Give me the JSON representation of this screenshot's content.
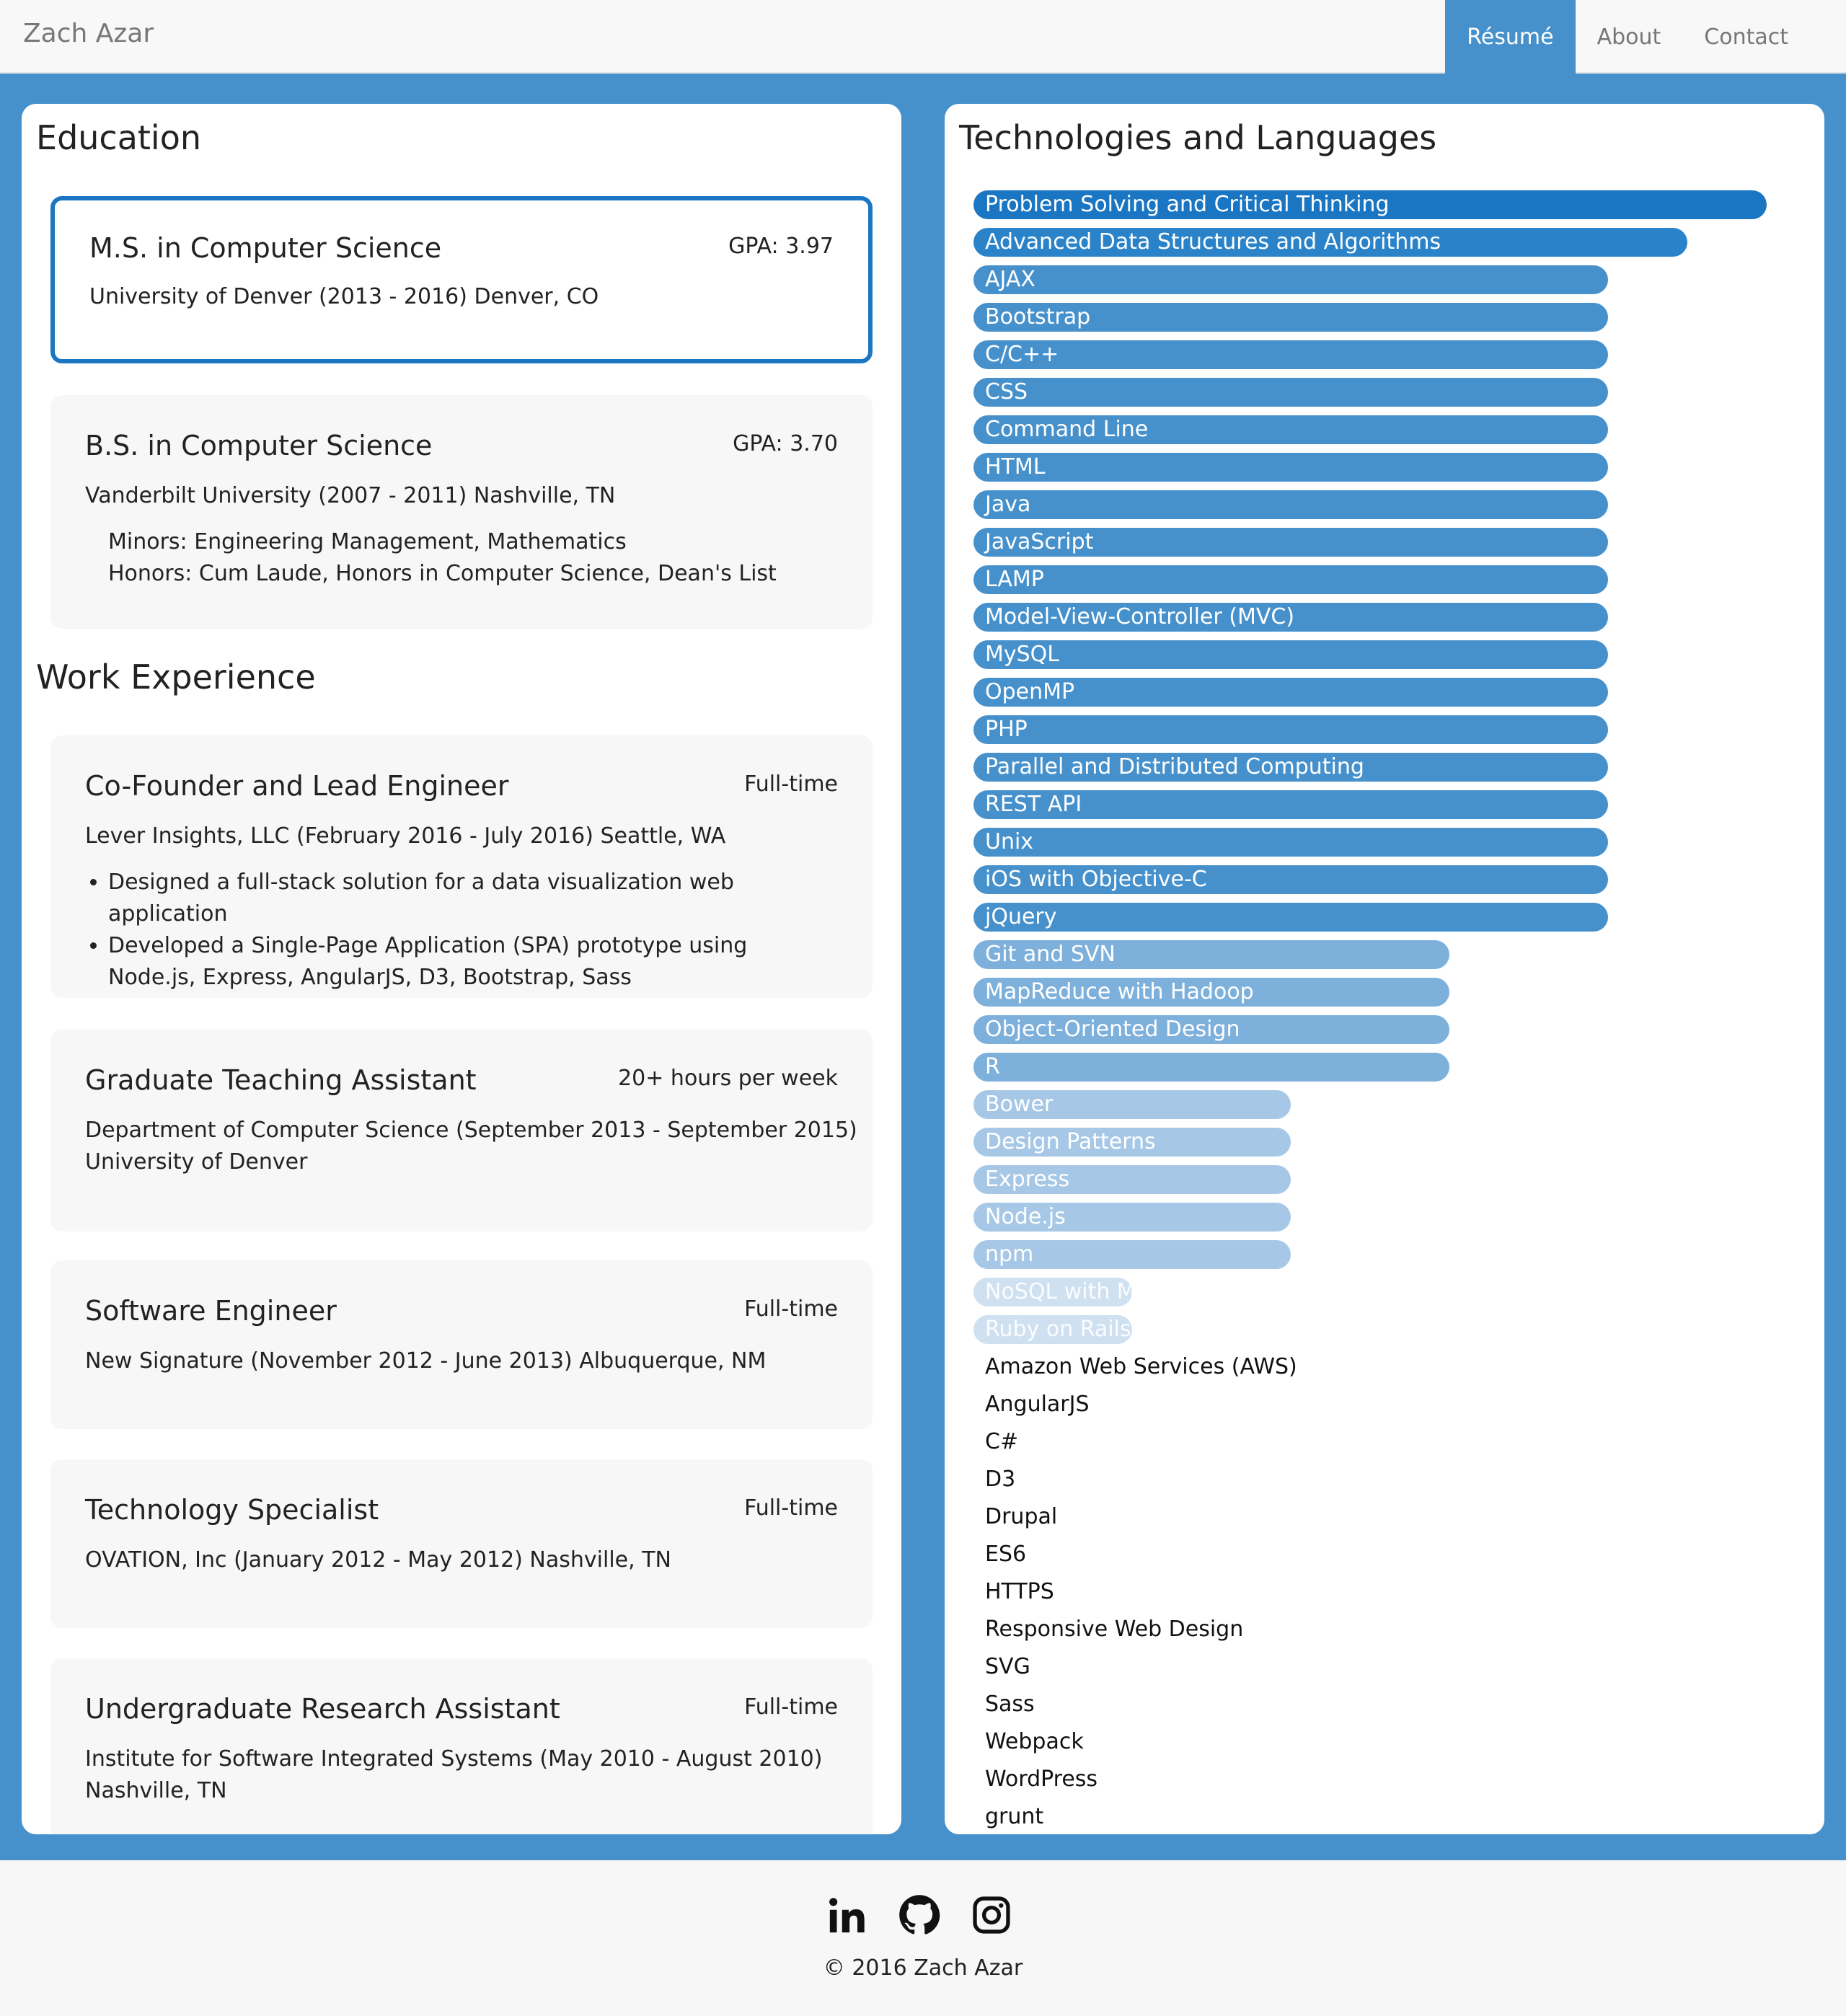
{
  "header": {
    "brand": "Zach Azar",
    "nav": [
      {
        "label": "Résumé",
        "active": true
      },
      {
        "label": "About",
        "active": false
      },
      {
        "label": "Contact",
        "active": false
      }
    ]
  },
  "education": {
    "title": "Education",
    "items": [
      {
        "degree": "M.S. in Computer Science",
        "gpa": "GPA: 3.97",
        "school": "University of Denver (2013 - 2016) Denver, CO"
      },
      {
        "degree": "B.S. in Computer Science",
        "gpa": "GPA: 3.70",
        "school": "Vanderbilt University (2007 - 2011) Nashville, TN",
        "minors": "Minors: Engineering Management, Mathematics",
        "honors": "Honors: Cum Laude, Honors in Computer Science, Dean's List"
      }
    ]
  },
  "work": {
    "title": "Work Experience",
    "items": [
      {
        "role": "Co-Founder and Lead Engineer",
        "type": "Full-time",
        "org": "Lever Insights, LLC (February 2016 - July 2016) Seattle, WA",
        "bullets": [
          "Designed a full-stack solution for a data visualization web application",
          "Developed a Single-Page Application (SPA) prototype using Node.js, Express, AngularJS, D3, Bootstrap, Sass"
        ]
      },
      {
        "role": "Graduate Teaching Assistant",
        "type": "20+ hours per week",
        "org": "Department of Computer Science (September 2013 - September 2015)",
        "org2": "University of Denver"
      },
      {
        "role": "Software Engineer",
        "type": "Full-time",
        "org": "New Signature (November 2012 - June 2013) Albuquerque, NM"
      },
      {
        "role": "Technology Specialist",
        "type": "Full-time",
        "org": "OVATION, Inc (January 2012 - May 2012) Nashville, TN"
      },
      {
        "role": "Undergraduate Research Assistant",
        "type": "Full-time",
        "org": "Institute for Software Integrated Systems (May 2010 - August 2010)",
        "org2": "Nashville, TN"
      }
    ]
  },
  "tech": {
    "title": "Technologies and Languages",
    "levels": {
      "10": "#1a76c2",
      "9": "#2a83c9",
      "8": "#4691cc",
      "6": "#7eb0dc",
      "4": "#a6c8e6",
      "2": "#cfe0f0"
    },
    "skills": [
      {
        "name": "Problem Solving and Critical Thinking",
        "level": 10
      },
      {
        "name": "Advanced Data Structures and Algorithms",
        "level": 9
      },
      {
        "name": "AJAX",
        "level": 8
      },
      {
        "name": "Bootstrap",
        "level": 8
      },
      {
        "name": "C/C++",
        "level": 8
      },
      {
        "name": "CSS",
        "level": 8
      },
      {
        "name": "Command Line",
        "level": 8
      },
      {
        "name": "HTML",
        "level": 8
      },
      {
        "name": "Java",
        "level": 8
      },
      {
        "name": "JavaScript",
        "level": 8
      },
      {
        "name": "LAMP",
        "level": 8
      },
      {
        "name": "Model-View-Controller (MVC)",
        "level": 8
      },
      {
        "name": "MySQL",
        "level": 8
      },
      {
        "name": "OpenMP",
        "level": 8
      },
      {
        "name": "PHP",
        "level": 8
      },
      {
        "name": "Parallel and Distributed Computing",
        "level": 8
      },
      {
        "name": "REST API",
        "level": 8
      },
      {
        "name": "Unix",
        "level": 8
      },
      {
        "name": "iOS with Objective-C",
        "level": 8
      },
      {
        "name": "jQuery",
        "level": 8
      },
      {
        "name": "Git and SVN",
        "level": 6
      },
      {
        "name": "MapReduce with Hadoop",
        "level": 6
      },
      {
        "name": "Object-Oriented Design",
        "level": 6
      },
      {
        "name": "R",
        "level": 6
      },
      {
        "name": "Bower",
        "level": 4
      },
      {
        "name": "Design Patterns",
        "level": 4
      },
      {
        "name": "Express",
        "level": 4
      },
      {
        "name": "Node.js",
        "level": 4
      },
      {
        "name": "npm",
        "level": 4
      },
      {
        "name": "NoSQL with MongoDB",
        "level": 2
      },
      {
        "name": "Ruby on Rails",
        "level": 2
      },
      {
        "name": "Amazon Web Services (AWS)",
        "level": 0
      },
      {
        "name": "AngularJS",
        "level": 0
      },
      {
        "name": "C#",
        "level": 0
      },
      {
        "name": "D3",
        "level": 0
      },
      {
        "name": "Drupal",
        "level": 0
      },
      {
        "name": "ES6",
        "level": 0
      },
      {
        "name": "HTTPS",
        "level": 0
      },
      {
        "name": "Responsive Web Design",
        "level": 0
      },
      {
        "name": "SVG",
        "level": 0
      },
      {
        "name": "Sass",
        "level": 0
      },
      {
        "name": "Webpack",
        "level": 0
      },
      {
        "name": "WordPress",
        "level": 0
      },
      {
        "name": "grunt",
        "level": 0
      }
    ]
  },
  "footer": {
    "icons": [
      "linkedin-icon",
      "github-icon",
      "instagram-icon"
    ],
    "copyright": "© 2016 Zach Azar"
  }
}
